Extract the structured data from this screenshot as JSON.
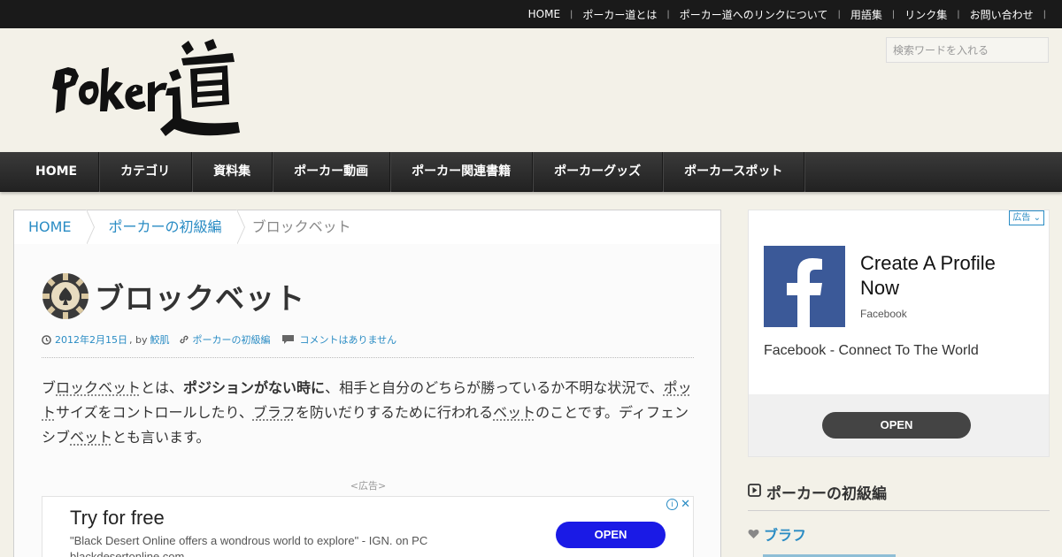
{
  "topnav": {
    "items": [
      "HOME",
      "ポーカー道とは",
      "ポーカー道へのリンクについて",
      "用語集",
      "リンク集",
      "お問い合わせ"
    ],
    "separator": "|"
  },
  "header": {
    "logo_text": "Poker道",
    "search_placeholder": "検索ワードを入れる"
  },
  "mainnav": {
    "items": [
      "HOME",
      "カテゴリ",
      "資料集",
      "ポーカー動画",
      "ポーカー関連書籍",
      "ポーカーグッズ",
      "ポーカースポット"
    ]
  },
  "breadcrumb": {
    "home": "HOME",
    "category": "ポーカーの初級編",
    "current": "ブロックベット"
  },
  "article": {
    "title": "ブロックベット",
    "date": "2012年2月15日",
    "by": ", by",
    "author": "鮫肌",
    "category": "ポーカーの初級編",
    "comments": "コメントはありません",
    "body": {
      "p1a": "ブ",
      "p1_kw1": "ロックベット",
      "p1b": "とは、",
      "p1_bold": "ポジションがない時に",
      "p1c": "、相手と自分のどちらが勝っているか不明な状況で、",
      "p1_kw2": "ポット",
      "p1d": "サイズをコントロールしたり、",
      "p1_kw3": "ブラフ",
      "p1e": "を防いだりするために行われる",
      "p1_kw4": "ベット",
      "p1f": "のことです。ディフェンシブ",
      "p1_kw5": "ベット",
      "p1g": "とも言います。"
    },
    "ad_label": "<広告>"
  },
  "inline_ad": {
    "headline": "Try for free",
    "quote": "\"Black Desert Online offers a wondrous world to explore\" - IGN. on PC",
    "url": "blackdesertonline.com",
    "open_label": "OPEN",
    "info": "i",
    "close": "✕"
  },
  "side_ad": {
    "badge": "広告",
    "title": "Create A Profile Now",
    "brand": "Facebook",
    "description": "Facebook - Connect To The World",
    "open_label": "OPEN",
    "logo_letter": "f"
  },
  "widget": {
    "title": "ポーカーの初級編",
    "first_item": "ブラフ"
  },
  "colors": {
    "link": "#2a8cc4",
    "topbar": "#1a1a1a",
    "background": "#f3f1e8",
    "nav": "#2b2b2b",
    "facebook": "#3b5998",
    "ad_button": "#1a1ae6"
  }
}
